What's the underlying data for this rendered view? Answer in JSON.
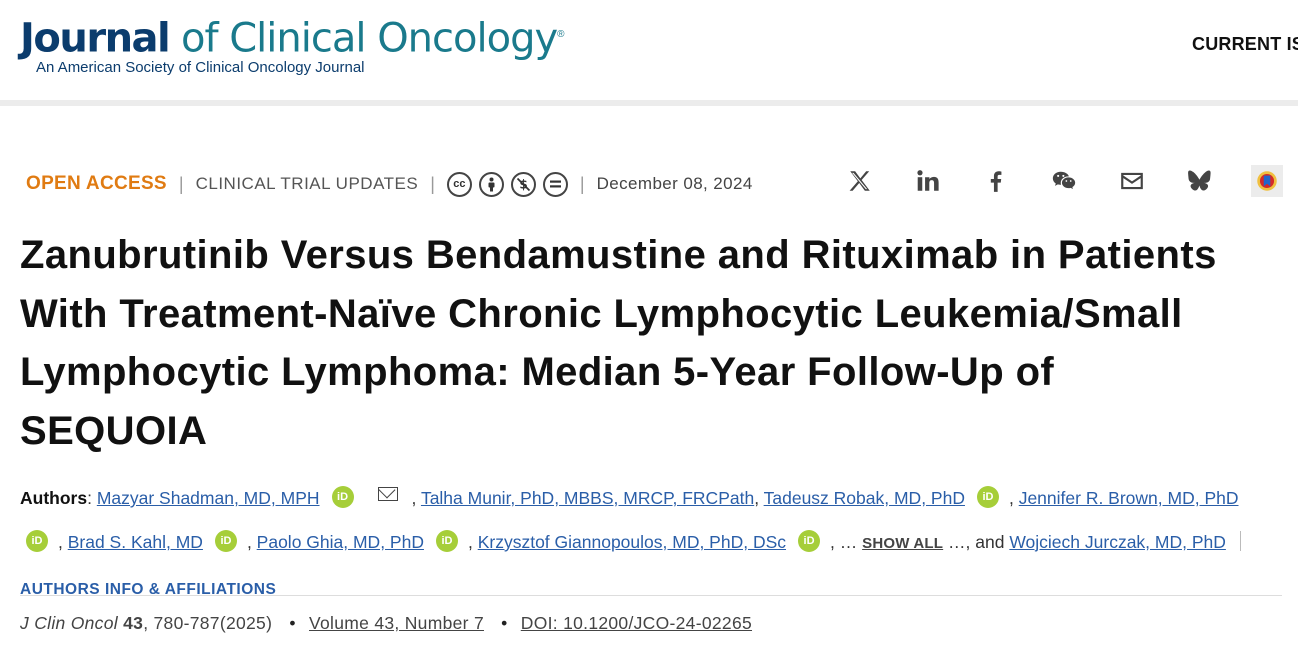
{
  "header": {
    "logo_bold": "Journal",
    "logo_rest": " of Clinical Oncology",
    "logo_reg": "®",
    "logo_subtitle": "An American Society of Clinical Oncology Journal",
    "nav_current": "CURRENT IS"
  },
  "meta": {
    "open_access": "OPEN ACCESS",
    "separator": "|",
    "article_type": "CLINICAL TRIAL UPDATES",
    "license_icons": [
      "cc",
      "by",
      "nc",
      "nd"
    ],
    "date": "December 08, 2024"
  },
  "share": {
    "icons": [
      "x-icon",
      "linkedin-icon",
      "facebook-icon",
      "wechat-icon",
      "email-icon",
      "bluesky-icon",
      "mendeley-icon"
    ]
  },
  "article": {
    "title": "Zanubrutinib Versus Bendamustine and Rituximab in Patients With Treatment-Naïve Chronic Lymphocytic Leukemia/Small Lymphocytic Lymphoma: Median 5-Year Follow-Up of SEQUOIA"
  },
  "authors": {
    "label": "Authors",
    "list": [
      "Mazyar Shadman, MD, MPH",
      "Talha Munir, PhD, MBBS, MRCP, FRCPath",
      "Tadeusz Robak, MD, PhD",
      "Jennifer R. Brown, MD, PhD",
      "Brad S. Kahl, MD",
      "Paolo Ghia, MD, PhD",
      "Krzysztof Giannopoulos, MD, PhD, DSc",
      "Wojciech Jurczak, MD, PhD"
    ],
    "show_all": "SHOW ALL",
    "ellipsis": "…",
    "and": ", and",
    "affiliations": "AUTHORS INFO & AFFILIATIONS",
    "orcid_text": "iD"
  },
  "citation": {
    "journal": "J Clin Oncol",
    "volume_bold": "43",
    "pages_year": ", 780-787(2025)",
    "issue": "Volume 43, Number 7",
    "doi": "DOI: 10.1200/JCO-24-02265",
    "bullet": "•"
  }
}
